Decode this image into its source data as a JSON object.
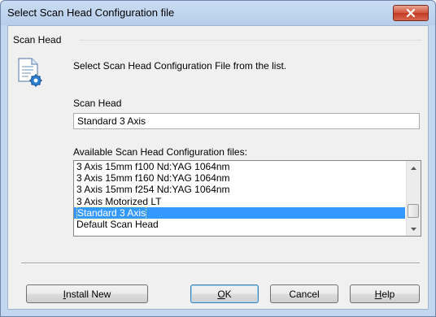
{
  "window": {
    "title": "Select Scan Head Configuration file"
  },
  "group": {
    "label": "Scan Head"
  },
  "description": "Select Scan Head Configuration File from the list.",
  "scan_head": {
    "label": "Scan Head",
    "value": "Standard 3 Axis"
  },
  "available": {
    "label": "Available Scan Head Configuration files:",
    "items": [
      "3 Axis 15mm f100 Nd:YAG 1064nm",
      "3 Axis 15mm f160 Nd:YAG 1064nm",
      "3 Axis 15mm f254 Nd:YAG 1064nm",
      "3 Axis Motorized LT",
      "Standard 3 Axis",
      "Default Scan Head"
    ],
    "selected_index": 4
  },
  "buttons": {
    "install_new": {
      "mnemonic": "I",
      "rest": "nstall New"
    },
    "ok": {
      "mnemonic": "O",
      "rest": "K"
    },
    "cancel": {
      "label": "Cancel"
    },
    "help": {
      "mnemonic": "H",
      "rest": "elp"
    }
  },
  "colors": {
    "selection": "#3399ff",
    "close_button": "#c23a22"
  },
  "icons": {
    "document": "document-settings-icon",
    "close": "close-icon"
  }
}
